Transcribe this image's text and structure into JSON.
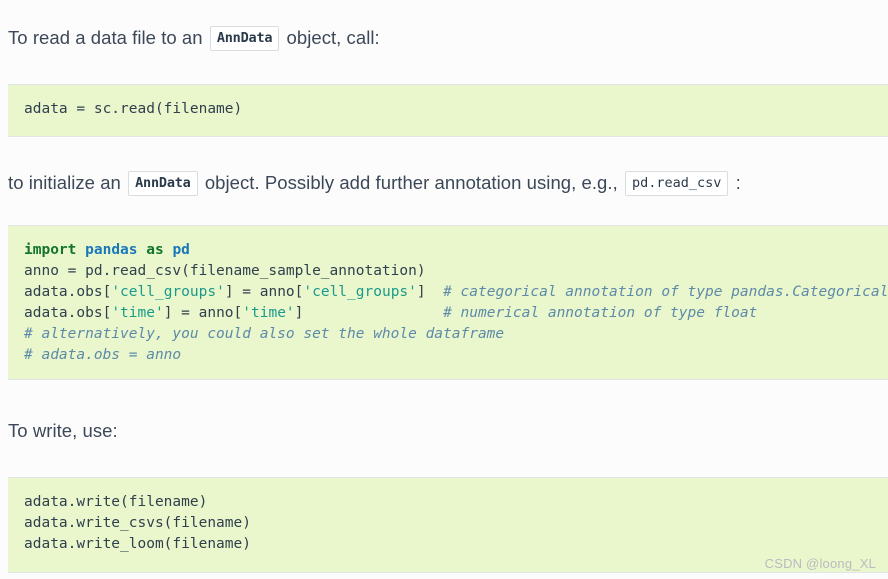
{
  "document": {
    "background_color": "#fcfcfc",
    "text_color": "#3c4858",
    "code_block_background": "#eaf7cd",
    "code_block_border": "#e2e6ea"
  },
  "paragraphs": {
    "p1_before": "To read a data file to an",
    "p1_code": "AnnData",
    "p1_after": "object, call:",
    "p2_before": "to initialize an",
    "p2_code": "AnnData",
    "p2_middle": "object. Possibly add further annotation using, e.g.,",
    "p2_code2": "pd.read_csv",
    "p2_after": ":",
    "p3": "To write, use:"
  },
  "code_blocks": {
    "block1": {
      "language": "python",
      "lines": [
        "adata = sc.read(filename)"
      ]
    },
    "block2": {
      "language": "python",
      "lines": [
        "import pandas as pd",
        "anno = pd.read_csv(filename_sample_annotation)",
        "adata.obs['cell_groups'] = anno['cell_groups']  # categorical annotation of type pandas.Categorical",
        "adata.obs['time'] = anno['time']                # numerical annotation of type float",
        "# alternatively, you could also set the whole dataframe",
        "# adata.obs = anno"
      ]
    },
    "block3": {
      "language": "python",
      "lines": [
        "adata.write(filename)",
        "adata.write_csvs(filename)",
        "adata.write_loom(filename)"
      ]
    }
  },
  "syntax_colors": {
    "keyword": "#13742b",
    "module_name": "#1878b8",
    "string": "#1a9a8a",
    "comment": "#5d8aa8",
    "plain": "#30404d"
  },
  "watermark": {
    "text": "CSDN @loong_XL",
    "color": "#b9bcbf"
  }
}
